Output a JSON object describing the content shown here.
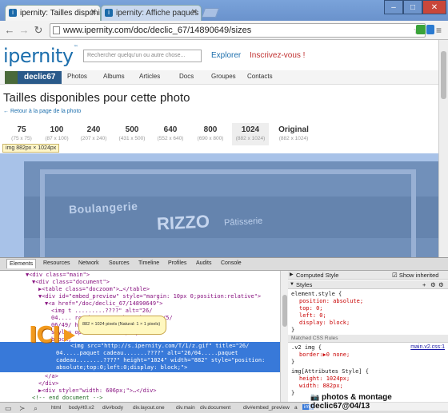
{
  "browser": {
    "tabs": [
      {
        "title": "ipernity: Tailles disponibles p",
        "active": true
      },
      {
        "title": "ipernity: Affiche paques Lu",
        "active": false
      }
    ],
    "url": "www.ipernity.com/doc/declic_67/14890649/sizes",
    "window_controls": {
      "minimize": "–",
      "maximize": "□",
      "close": "✕"
    }
  },
  "site": {
    "logo": "ipernity",
    "logo_tm": "™",
    "search_placeholder": "Rechercher quelqu'un ou autre chose...",
    "explorer": "Explorer",
    "signup": "Inscrivez-vous !",
    "user": "declic67",
    "nav": [
      "Photos",
      "Albums",
      "Articles",
      "Docs",
      "Groupes",
      "Contacts"
    ],
    "title": "Tailles disponibles pour cette photo",
    "back_link": "← Retour à la page de la photo",
    "sizes": [
      {
        "label": "75",
        "dims": "(75 x 75)",
        "selected": false
      },
      {
        "label": "100",
        "dims": "(87 x 100)",
        "selected": false
      },
      {
        "label": "240",
        "dims": "(207 x 240)",
        "selected": false
      },
      {
        "label": "500",
        "dims": "(431 x 500)",
        "selected": false
      },
      {
        "label": "640",
        "dims": "(552 x 640)",
        "selected": false
      },
      {
        "label": "800",
        "dims": "(690 x 800)",
        "selected": false
      },
      {
        "label": "1024",
        "dims": "(882 x 1024)",
        "selected": true
      },
      {
        "label": "Original",
        "dims": "(882 x 1024)",
        "selected": false
      }
    ],
    "img_tip": "img 882px × 1024px",
    "photo_text": [
      "Boulangerie",
      "RIZZO",
      "Pâtisserie"
    ]
  },
  "devtools": {
    "tabs": [
      "Elements",
      "Resources",
      "Network",
      "Sources",
      "Timeline",
      "Profiles",
      "Audits",
      "Console"
    ],
    "dom_lines": [
      "▼<div class=\"main\">",
      "▼<div class=\"document\">",
      "▶<table class=\"doczoom\">…</table>",
      "▼<div id=\"embed_preview\" style=\"margin: 10px 0;position:relative\">",
      "▼<a href=\"/doc/declic_67/14890649\">",
      "<img t                          .........????\" alt=\"26/",
      "04....                          rc=\"http://u1.ipernity.com/5/",
      "06/49/                          ht=\"1024\" width=\"882\"",
      "style=                          op:0;left:0;display:",
      "block;"
    ],
    "selected_lines": [
      "<img src=\"http://s.ipernity.com/T/1/z.gif\" title=\"26/",
      "04.....paquet cadeau.......????\" alt=\"26/04.....paquet",
      "cadeau........????\" height=\"1024\" width=\"882\" style=\"position:",
      "absolute;top:0;left:0;display: block;\">"
    ],
    "after_lines": [
      "</a>",
      "</div>",
      "▶<div style=\"width: 606px;\">…</div>",
      "<!-- end document -->"
    ],
    "tooltip": "882 × 1024 pixels (Natural: 1 × 1 pixels)",
    "computed_style": "Computed Style",
    "show_inherited": "Show inherited",
    "styles_header": "Styles",
    "element_style": "element.style {",
    "element_props": [
      "position: absolute;",
      "top: 0;",
      "left: 0;",
      "display: block;"
    ],
    "matched_rules": "Matched CSS Rules",
    "rule1_selector": ".v2 img {",
    "rule1_link": "main.v2.css:1",
    "rule1_props": [
      "border:▶0 none;"
    ],
    "rule2_selector": "img[Attributes Style] {",
    "rule2_props": [
      "height: 1024px;",
      "width: 882px;"
    ],
    "breadcrumbs": [
      "html",
      "body#t0.v2",
      "div#body",
      "div.layout.one",
      "div.main",
      "div.document",
      "div#embed_preview",
      "a",
      "img"
    ],
    "annotation": "ICI"
  },
  "watermark": "photos & montage  declic67@04/13"
}
